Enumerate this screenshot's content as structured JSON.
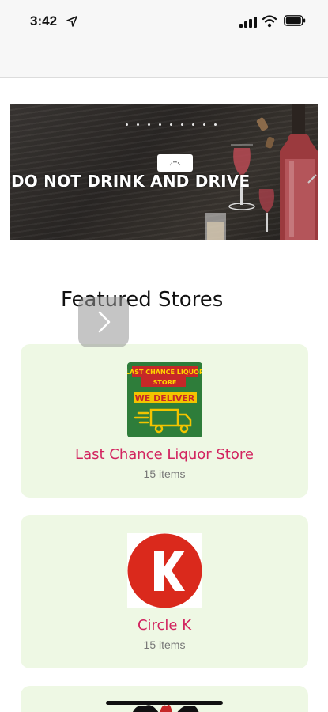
{
  "status": {
    "time": "3:42"
  },
  "banner": {
    "text": "DO NOT DRINK AND DRIVE",
    "slide_count": 9
  },
  "section": {
    "title": "Featured Stores"
  },
  "stores": [
    {
      "name": "Last Chance Liquor Store",
      "items": "15 items",
      "logo_text_top": "LAST CHANCE LIQUOR STORE",
      "logo_text_mid": "WE DELIVER"
    },
    {
      "name": "Circle K",
      "items": "15 items",
      "logo_letter": "K"
    },
    {
      "name": "",
      "items": ""
    }
  ],
  "colors": {
    "accent": "#d2245f",
    "card_bg": "#eef8e4",
    "logo1_bg": "#2e7d3a",
    "circlek_red": "#da291c"
  }
}
